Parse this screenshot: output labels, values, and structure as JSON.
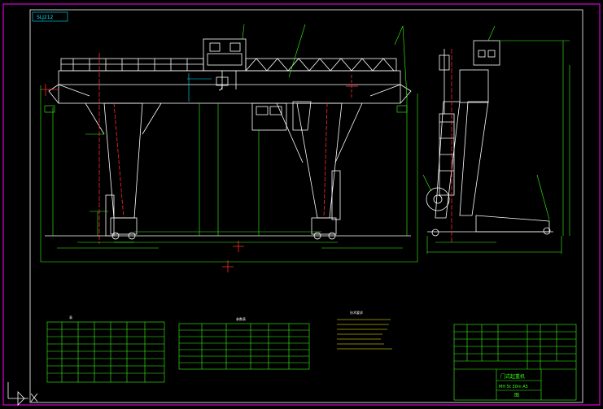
{
  "tag_label": "SLJ212",
  "notes": {
    "title": "技术要求",
    "lines": [
      "1",
      "2",
      "3",
      "4",
      "5",
      "6"
    ]
  },
  "main_table": {
    "header_mark": "表",
    "rows": 8,
    "cols": 8
  },
  "mid_table": {
    "header_mark": "参数表",
    "rows": 7,
    "cols": 6
  },
  "right_table": {
    "rows": 6,
    "cols": 6
  },
  "title_block": {
    "name": "门式起重机",
    "code": "MH 5t 30m A5",
    "mark": "图"
  },
  "colors": {
    "background": "#000000",
    "frame": "#ff00ff",
    "outline": "#ffffff",
    "dimension": "#39ff14",
    "centerline": "#ff2a2a"
  }
}
